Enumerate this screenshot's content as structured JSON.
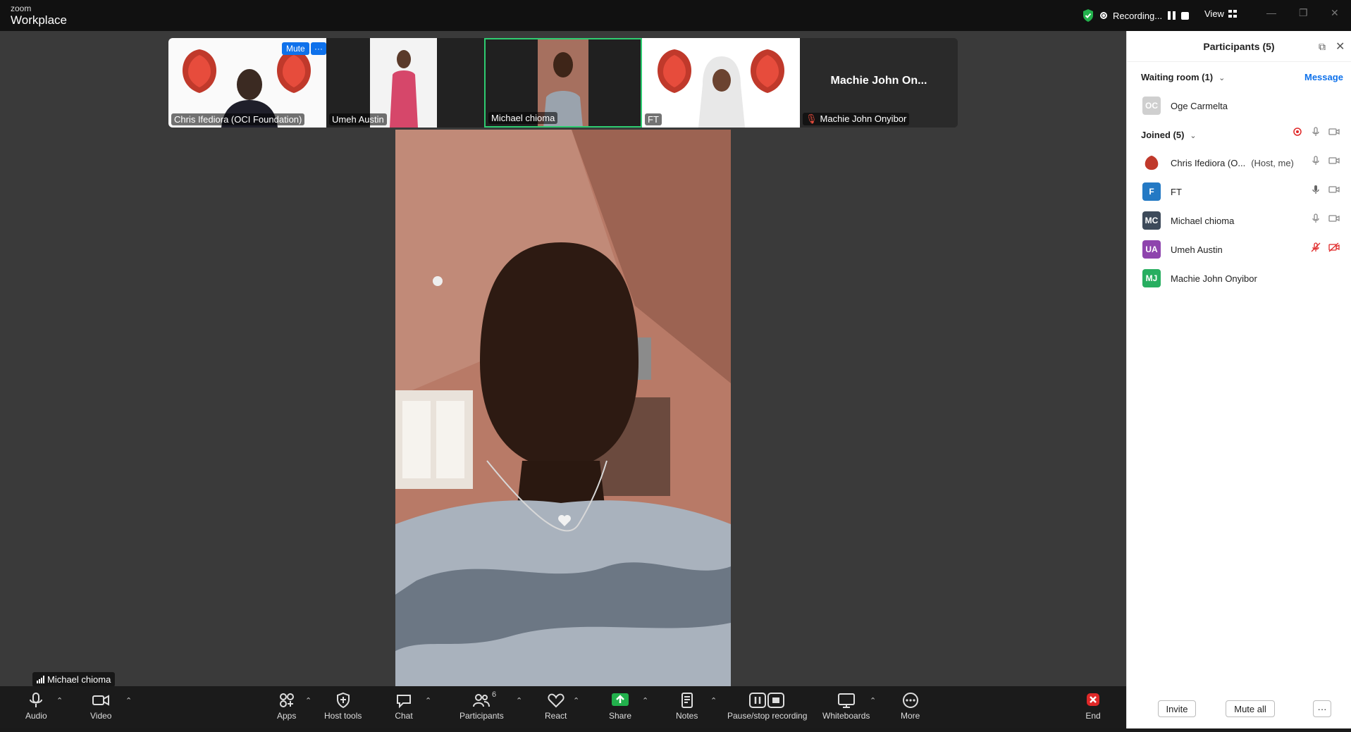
{
  "app": {
    "logo_small": "zoom",
    "logo_big": "Workplace",
    "recording_label": "Recording...",
    "view_label": "View"
  },
  "thumbnails": [
    {
      "name": "Chris Ifediora (OCI Foundation)",
      "mute_label": "Mute",
      "more_label": "···"
    },
    {
      "name": "Umeh Austin"
    },
    {
      "name": "Michael chioma"
    },
    {
      "name": "FT"
    },
    {
      "name": "Machie John Onyibor",
      "display_name": "Machie John On..."
    }
  ],
  "active_speaker": {
    "name": "Michael chioma"
  },
  "toolbar": {
    "audio": "Audio",
    "video": "Video",
    "apps": "Apps",
    "host_tools": "Host tools",
    "chat": "Chat",
    "participants": "Participants",
    "participants_count": "6",
    "react": "React",
    "share": "Share",
    "notes": "Notes",
    "recording": "Pause/stop recording",
    "whiteboards": "Whiteboards",
    "more": "More",
    "end": "End"
  },
  "sidebar": {
    "title": "Participants (5)",
    "waiting_room_label": "Waiting room (1)",
    "message_label": "Message",
    "waiting": [
      {
        "initials": "OC",
        "name": "Oge Carmelta",
        "color": "#cfcfcf"
      }
    ],
    "joined_label": "Joined (5)",
    "joined": [
      {
        "initials": "",
        "name": "Chris Ifediora (O...",
        "extra": "(Host, me)",
        "color": "#c0392b"
      },
      {
        "initials": "F",
        "name": "FT",
        "extra": "",
        "color": "#2479c4"
      },
      {
        "initials": "MC",
        "name": "Michael chioma",
        "extra": "",
        "color": "#3d4a5a"
      },
      {
        "initials": "UA",
        "name": "Umeh Austin",
        "extra": "",
        "color": "#8e44ad"
      },
      {
        "initials": "MJ",
        "name": "Machie John Onyibor",
        "extra": "",
        "color": "#27ae60"
      }
    ],
    "invite_label": "Invite",
    "mute_all_label": "Mute all",
    "more_label": "···"
  }
}
